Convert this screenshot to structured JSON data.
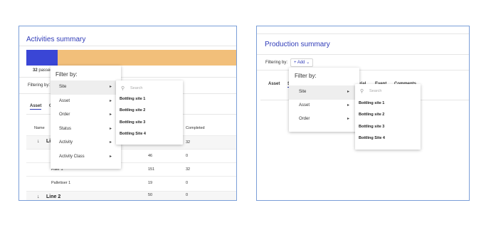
{
  "left": {
    "title": "Activities summary",
    "progress_fraction": 0.147,
    "progress_colors": {
      "fill": "#3a46d6",
      "rest": "#f2bf7a"
    },
    "passed_count": "32",
    "passed_label": "passed",
    "filtering_label": "Filtering by:",
    "tabs": [
      "Asset",
      "O"
    ],
    "columns": {
      "name": "Name",
      "completed": "Completed"
    },
    "rows": [
      {
        "type": "group",
        "name": "Li",
        "value": "",
        "completed": "32"
      },
      {
        "type": "row",
        "name": "",
        "value": "46",
        "completed": "0"
      },
      {
        "type": "row",
        "name": "Filler 1",
        "value": "151",
        "completed": "32"
      },
      {
        "type": "row",
        "name": "Palletiser 1",
        "value": "19",
        "completed": "0"
      },
      {
        "type": "group",
        "name": "Line 2",
        "value": "50",
        "completed": "0"
      }
    ],
    "filter_menu": {
      "title": "Filter by:",
      "items": [
        "Site",
        "Asset",
        "Order",
        "Status",
        "Activity",
        "Activity Class"
      ]
    },
    "site_submenu": {
      "search_placeholder": "Search",
      "items": [
        "Bottling site 1",
        "Bottling site 2",
        "Bottling site 3",
        "Bottling Site 4"
      ]
    }
  },
  "right": {
    "title": "Production summary",
    "filtering_label": "Filtering by:",
    "add_label": "+ Add",
    "tabs": [
      "Asset",
      "S",
      "erial",
      "Event",
      "Comments"
    ],
    "filter_menu": {
      "title": "Filter by:",
      "items": [
        "Site",
        "Asset",
        "Order"
      ]
    },
    "site_submenu": {
      "search_placeholder": "Search",
      "items": [
        "Bottling site 1",
        "Bottling site 2",
        "Bottling site 3",
        "Bottling Site 4"
      ]
    }
  }
}
